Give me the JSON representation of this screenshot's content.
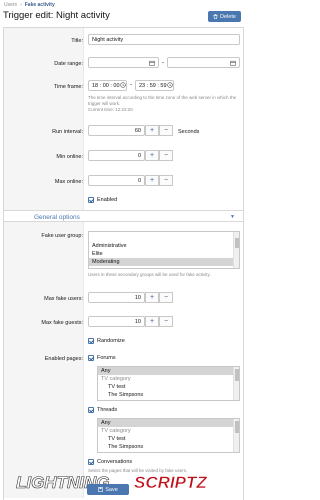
{
  "breadcrumb": {
    "item1": "Users",
    "item2": "Fake activity"
  },
  "header": {
    "title": "Trigger edit: Night activity",
    "delete_label": "Delete"
  },
  "form": {
    "title_label": "Title:",
    "title_value": "Night activity",
    "date_range_label": "Date range:",
    "date_range_sep": "-",
    "time_frame_label": "Time frame:",
    "time_from": "18 : 00 : 00",
    "time_to": "23 : 59 : 59",
    "time_hint": "The time interval according to the time zone of the web server in which the trigger will work.",
    "current_time": "Current time: 12:23:20",
    "run_interval_label": "Run interval:",
    "run_interval_value": "60",
    "run_interval_unit": "Seconds",
    "min_online_label": "Min online:",
    "min_online_value": "0",
    "max_online_label": "Max online:",
    "max_online_value": "0",
    "enabled_label": "Enabled"
  },
  "general_options": {
    "section_title": "General options",
    "fake_group_label": "Fake user group:",
    "groups": [
      "Administrative",
      "Elite",
      "Moderating"
    ],
    "groups_hint": "Users in these secondary groups will be used for fake activity.",
    "max_users_label": "Max fake users:",
    "max_users_value": "10",
    "max_guests_label": "Max fake guests:",
    "max_guests_value": "10",
    "randomize_label": "Randomize",
    "enabled_pages_label": "Enabled pages:",
    "forums_label": "Forums",
    "forums_list": [
      "Any",
      "TV category",
      "TV test",
      "The Simpsons"
    ],
    "threads_label": "Threads",
    "threads_list": [
      "Any",
      "TV category",
      "TV test",
      "The Simpsons"
    ],
    "conversations_label": "Conversations",
    "pages_hint": "Select the pages that will be visited by fake users."
  },
  "footer": {
    "save_label": "Save"
  },
  "colors": {
    "accent": "#4a77b0",
    "selected": "#d4d4d4"
  },
  "icons": {
    "delete": "trash-icon",
    "save": "save-icon",
    "calendar": "calendar-icon",
    "clock": "clock-icon",
    "chevron": "chevron-down-icon"
  },
  "watermark_text": "LIGHTNINGSCRIPTZ"
}
